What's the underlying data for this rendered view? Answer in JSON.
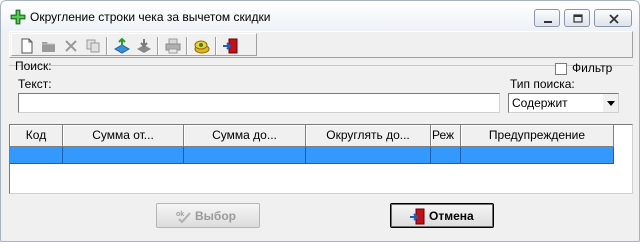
{
  "window": {
    "title": "Округление строки чека за вычетом скидки"
  },
  "toolbar": {
    "icons": [
      "new-document",
      "open-folder",
      "delete",
      "copy",
      "export",
      "import",
      "print",
      "money-coins",
      "exit-door"
    ]
  },
  "search": {
    "group_label": "Поиск:",
    "filter_label": "Фильтр",
    "filter_checked": false,
    "text_label": "Текст:",
    "text_value": "",
    "type_label": "Тип поиска:",
    "type_value": "Содержит"
  },
  "grid": {
    "columns": [
      "Код",
      "Сумма от...",
      "Сумма до...",
      "Округлять до...",
      "Режим",
      "Предупреждение"
    ],
    "visible_columns_text": [
      "Код",
      "Сумма от...",
      "Сумма до...",
      "Округлять до...",
      "Реж",
      "Предупреждение"
    ],
    "rows": [
      [
        "",
        "",
        "",
        "",
        "",
        ""
      ]
    ],
    "selected_row": 0,
    "selection_color": "#3399ff"
  },
  "buttons": {
    "select_label": "Выбор",
    "select_enabled": false,
    "cancel_label": "Отмена"
  },
  "colors": {
    "window_bg": "#f0f0f0",
    "app_icon": "#2e9b2e",
    "exit_red": "#c0101a"
  }
}
